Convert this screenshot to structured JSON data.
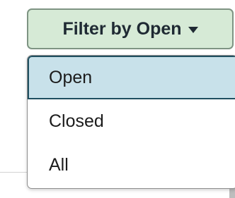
{
  "filter": {
    "button_label": "Filter by Open",
    "selected": "Open",
    "options": [
      {
        "label": "Open"
      },
      {
        "label": "Closed"
      },
      {
        "label": "All"
      }
    ]
  },
  "icons": {
    "caret": "caret-down-icon"
  },
  "colors": {
    "button_bg": "#d6ead6",
    "button_border": "#7e9483",
    "selected_bg": "#c8e1ea",
    "selected_border": "#1f4f60"
  }
}
